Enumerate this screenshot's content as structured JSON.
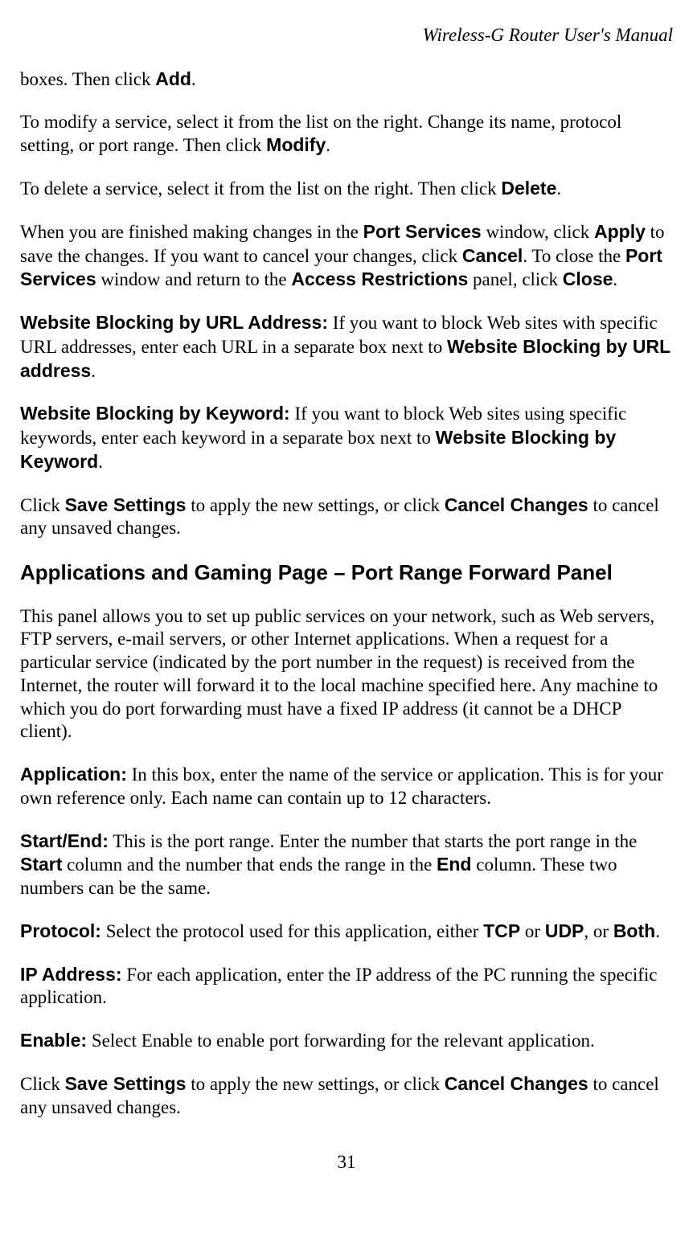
{
  "header": {
    "title": "Wireless-G Router User's Manual"
  },
  "content": {
    "p1_a": "boxes. Then click ",
    "p1_b": "Add",
    "p1_c": ".",
    "p2_a": "To modify a service, select it from the list on the right. Change its name, protocol setting, or port range. Then click ",
    "p2_b": "Modify",
    "p2_c": ".",
    "p3_a": "To delete a service, select it from the list on the right. Then click ",
    "p3_b": "Delete",
    "p3_c": ".",
    "p4_a": "When you are finished making changes in the ",
    "p4_b": "Port Services",
    "p4_c": " window, click ",
    "p4_d": "Apply",
    "p4_e": " to save the changes. If you want to cancel your changes, click ",
    "p4_f": "Cancel",
    "p4_g": ". To close the ",
    "p4_h": "Port Services",
    "p4_i": " window and return to the ",
    "p4_j": "Access Restrictions",
    "p4_k": " panel, click ",
    "p4_l": "Close",
    "p4_m": ".",
    "p5_a": "Website Blocking by URL Address:",
    "p5_b": " If you want to block Web sites with specific URL addresses, enter each URL in a separate box next to ",
    "p5_c": "Website Blocking by URL address",
    "p5_d": ".",
    "p6_a": "Website Blocking by Keyword:",
    "p6_b": " If you want to block Web sites using specific keywords, enter each keyword in a separate box next to ",
    "p6_c": "Website Blocking by Keyword",
    "p6_d": ".",
    "p7_a": "Click ",
    "p7_b": "Save Settings",
    "p7_c": " to apply the new settings, or click ",
    "p7_d": "Cancel Changes",
    "p7_e": " to cancel any unsaved changes.",
    "h2": "Applications and Gaming Page – Port Range Forward Panel",
    "p8": "This panel allows you to set up public services on your network, such as Web servers, FTP servers, e-mail servers, or other Internet applications. When a request for a particular service (indicated by the port number in the request) is received from the Internet, the router will forward it to the local machine specified here. Any machine to which you do port forwarding must have a fixed IP address (it cannot be a DHCP client).",
    "p9_a": "Application:",
    "p9_b": " In this box, enter the name of the service or application. This is for your own reference only. Each name can contain up to 12 characters.",
    "p10_a": "Start/End:",
    "p10_b": " This is the port range. Enter the number that starts the port range in the ",
    "p10_c": "Start",
    "p10_d": " column and the number that ends the range in the ",
    "p10_e": "End",
    "p10_f": " column. These two numbers can be the same.",
    "p11_a": "Protocol:",
    "p11_b": " Select the protocol used for this application, either ",
    "p11_c": "TCP",
    "p11_d": " or ",
    "p11_e": "UDP",
    "p11_f": ", or ",
    "p11_g": "Both",
    "p11_h": ".",
    "p12_a": "IP Address:",
    "p12_b": " For each application, enter the IP address of the PC running the specific application.",
    "p13_a": "Enable:",
    "p13_b": " Select Enable to enable port forwarding for the relevant application.",
    "p14_a": "Click ",
    "p14_b": "Save Settings",
    "p14_c": " to apply the new settings, or click ",
    "p14_d": "Cancel Changes",
    "p14_e": " to cancel any unsaved changes."
  },
  "footer": {
    "page_number": "31"
  }
}
